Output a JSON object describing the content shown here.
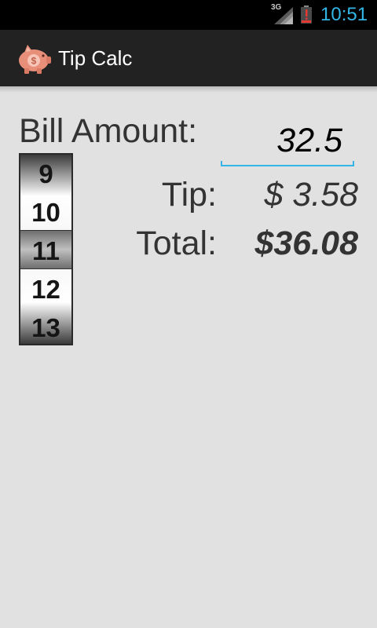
{
  "status_bar": {
    "network_type": "3G",
    "time": "10:51",
    "time_color": "#33b5e5",
    "battery_level": 0.15,
    "battery_alert": "!",
    "battery_icon": "battery-alert-icon",
    "signal_icon": "signal-icon"
  },
  "action_bar": {
    "title": "Tip Calc",
    "icon": "piggy-bank-icon",
    "icon_symbol": "$"
  },
  "bill": {
    "label": "Bill Amount:",
    "value": "32.5"
  },
  "tip_picker": {
    "items": [
      "9",
      "10",
      "11",
      "12",
      "13"
    ],
    "selected": "11"
  },
  "results": {
    "tip_label": "Tip:",
    "tip_value": "$ 3.58",
    "total_label": "Total:",
    "total_value": "$36.08"
  },
  "colors": {
    "accent": "#33b5e5",
    "background": "#e1e1e1",
    "action_bar": "#222222",
    "text": "#333333"
  }
}
